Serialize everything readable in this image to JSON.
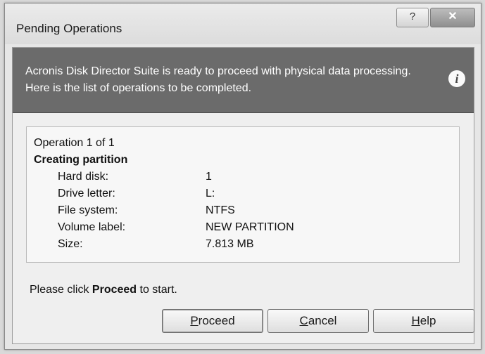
{
  "window": {
    "title": "Pending Operations",
    "help_button": "?",
    "close_button": "✕"
  },
  "banner": {
    "message": "Acronis Disk Director Suite is ready to proceed with physical data processing. Here is the list of operations to be completed.",
    "icon": "info-icon"
  },
  "operations": {
    "counter": "Operation 1 of 1",
    "title": "Creating partition",
    "details": [
      {
        "label": "Hard disk:",
        "value": "1"
      },
      {
        "label": "Drive letter:",
        "value": "L:"
      },
      {
        "label": "File system:",
        "value": "NTFS"
      },
      {
        "label": "Volume label:",
        "value": "NEW PARTITION"
      },
      {
        "label": "Size:",
        "value": "7.813 MB"
      }
    ]
  },
  "prompt": {
    "before": "Please click ",
    "bold": "Proceed",
    "after": " to start."
  },
  "buttons": {
    "proceed_key": "P",
    "proceed_rest": "roceed",
    "cancel_key": "C",
    "cancel_rest": "ancel",
    "help_key": "H",
    "help_rest": "elp"
  }
}
